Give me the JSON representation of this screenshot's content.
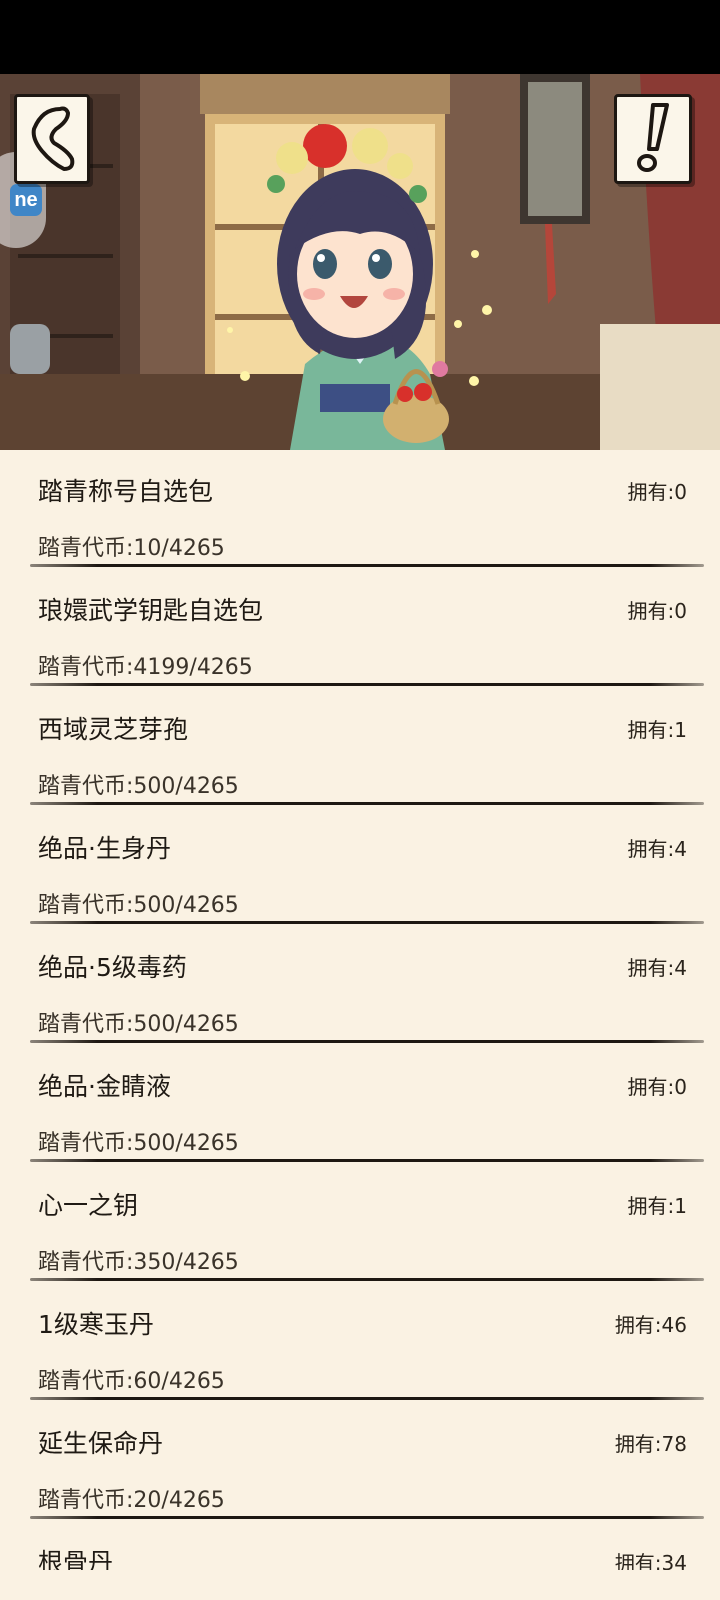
{
  "header": {
    "back_icon": "back-arrow-icon",
    "info_icon": "exclamation-icon",
    "side_badge_label": "ne"
  },
  "shop": {
    "owned_prefix": "拥有:",
    "items": [
      {
        "name": "踏青称号自选包",
        "owned": "拥有:0",
        "price": "踏青代币:10/4265"
      },
      {
        "name": "琅嬛武学钥匙自选包",
        "owned": "拥有:0",
        "price": "踏青代币:4199/4265"
      },
      {
        "name": "西域灵芝芽孢",
        "owned": "拥有:1",
        "price": "踏青代币:500/4265"
      },
      {
        "name": "绝品·生身丹",
        "owned": "拥有:4",
        "price": "踏青代币:500/4265"
      },
      {
        "name": "绝品·5级毒药",
        "owned": "拥有:4",
        "price": "踏青代币:500/4265"
      },
      {
        "name": "绝品·金睛液",
        "owned": "拥有:0",
        "price": "踏青代币:500/4265"
      },
      {
        "name": "心一之钥",
        "owned": "拥有:1",
        "price": "踏青代币:350/4265"
      },
      {
        "name": "1级寒玉丹",
        "owned": "拥有:46",
        "price": "踏青代币:60/4265"
      },
      {
        "name": "延生保命丹",
        "owned": "拥有:78",
        "price": "踏青代币:20/4265"
      },
      {
        "name": "根骨丹",
        "owned": "拥有:34",
        "price": ""
      }
    ]
  },
  "colors": {
    "background": "#faf2e3",
    "text": "#1f1a14",
    "divider": "#1e1812"
  }
}
